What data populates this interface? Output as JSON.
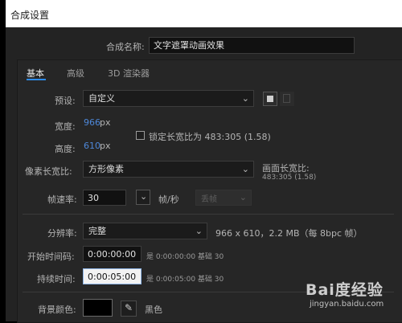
{
  "window": {
    "title": "合成设置"
  },
  "comp_name": {
    "label": "合成名称:",
    "value": "文字遮罩动画效果"
  },
  "tabs": [
    {
      "label": "基本",
      "active": true
    },
    {
      "label": "高级",
      "active": false
    },
    {
      "label": "3D 渲染器",
      "active": false
    }
  ],
  "preset": {
    "label": "预设:",
    "value": "自定义"
  },
  "width": {
    "label": "宽度:",
    "value": "966",
    "unit": "px"
  },
  "height": {
    "label": "高度:",
    "value": "610",
    "unit": "px"
  },
  "lock_aspect": {
    "label": "锁定长宽比为 483:305 (1.58)",
    "checked": false
  },
  "pixel_aspect": {
    "label": "像素长宽比:",
    "value": "方形像素"
  },
  "frame_aspect": {
    "label": "画面长宽比:",
    "value": "483:305 (1.58)"
  },
  "frame_rate": {
    "label": "帧速率:",
    "value": "30",
    "unit": "帧/秒",
    "drop_frame": "丢帧"
  },
  "resolution": {
    "label": "分辨率:",
    "value": "完整",
    "info": "966 x 610，2.2 MB（每 8bpc 帧）"
  },
  "start_timecode": {
    "label": "开始时间码:",
    "value": "0:00:00:00",
    "info": "是 0:00:00:00  基础 30"
  },
  "duration": {
    "label": "持续时间:",
    "value": "0:00:05:00",
    "info": "是 0:00:05:00  基础 30"
  },
  "bg_color": {
    "label": "背景颜色:",
    "name": "黑色",
    "swatch": "#000000"
  },
  "watermark": {
    "text": "Bai度经验",
    "url": "jingyan.baidu.com"
  },
  "colors": {
    "accent": "#2d8ceb",
    "value_blue": "#4e88d9"
  }
}
